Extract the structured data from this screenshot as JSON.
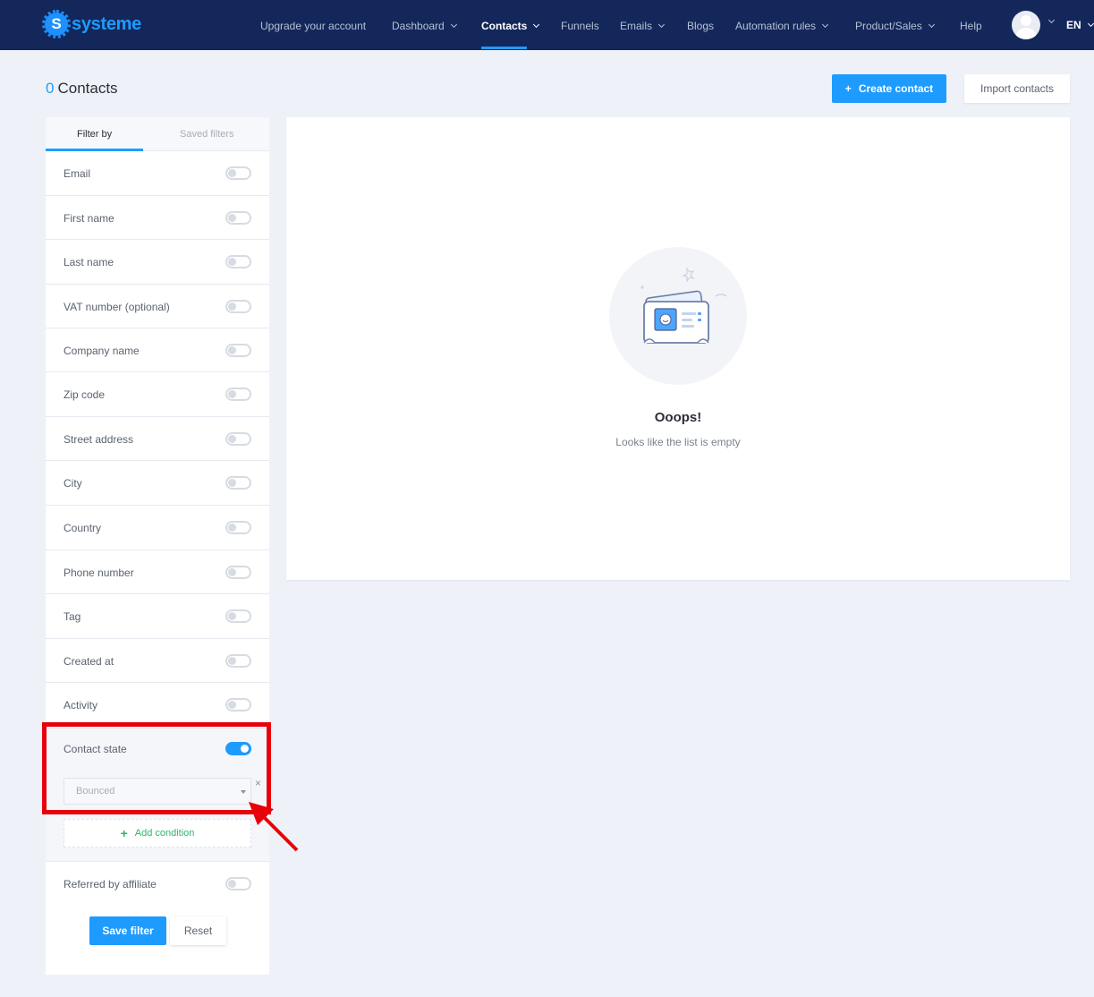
{
  "brand": {
    "name": "systeme"
  },
  "nav": {
    "items": [
      {
        "label": "Upgrade your account",
        "has_dropdown": false
      },
      {
        "label": "Dashboard",
        "has_dropdown": true
      },
      {
        "label": "Contacts",
        "has_dropdown": true,
        "active": true
      },
      {
        "label": "Funnels",
        "has_dropdown": false
      },
      {
        "label": "Emails",
        "has_dropdown": true
      },
      {
        "label": "Blogs",
        "has_dropdown": false
      },
      {
        "label": "Automation rules",
        "has_dropdown": true
      },
      {
        "label": "Product/Sales",
        "has_dropdown": true
      },
      {
        "label": "Help",
        "has_dropdown": false
      }
    ],
    "language": "EN"
  },
  "page": {
    "count": "0",
    "title": "Contacts",
    "create_button": "Create contact",
    "create_icon": "+",
    "import_button": "Import contacts"
  },
  "sidebar": {
    "tabs": [
      {
        "label": "Filter by",
        "active": true
      },
      {
        "label": "Saved filters",
        "active": false
      }
    ],
    "filters": [
      {
        "label": "Email",
        "enabled": false
      },
      {
        "label": "First name",
        "enabled": false
      },
      {
        "label": "Last name",
        "enabled": false
      },
      {
        "label": "VAT number (optional)",
        "enabled": false
      },
      {
        "label": "Company name",
        "enabled": false
      },
      {
        "label": "Zip code",
        "enabled": false
      },
      {
        "label": "Street address",
        "enabled": false
      },
      {
        "label": "City",
        "enabled": false
      },
      {
        "label": "Country",
        "enabled": false
      },
      {
        "label": "Phone number",
        "enabled": false
      },
      {
        "label": "Tag",
        "enabled": false
      },
      {
        "label": "Created at",
        "enabled": false
      },
      {
        "label": "Activity",
        "enabled": false
      }
    ],
    "contact_state": {
      "label": "Contact state",
      "enabled": true,
      "select_value": "Bounced",
      "remove_icon": "×",
      "add_condition_icon": "+",
      "add_condition": "Add condition"
    },
    "referred": {
      "label": "Referred by affiliate",
      "enabled": false
    },
    "save_button": "Save filter",
    "reset_button": "Reset"
  },
  "empty_state": {
    "title": "Ooops!",
    "subtitle": "Looks like the list is empty"
  },
  "colors": {
    "navbar": "#13275a",
    "accent": "#1e9bff",
    "success": "#2fb36e",
    "annotation": "#e8000b"
  }
}
